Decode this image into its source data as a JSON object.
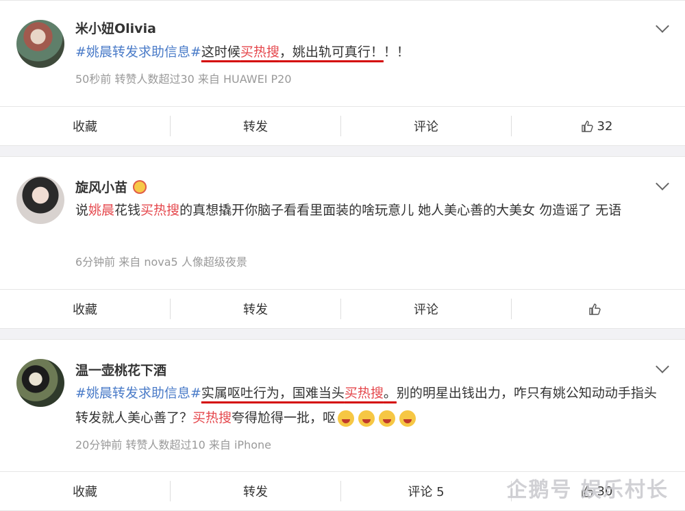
{
  "posts": [
    {
      "username": "米小妞Olivia",
      "text_segments": [
        "#姚晨转发求助信息#",
        "这时候",
        "买热搜",
        "，姚出轨可真行！",
        "！！"
      ],
      "meta": "50秒前  转赞人数超过30  来自 HUAWEI P20",
      "actions": {
        "fav": "收藏",
        "repost": "转发",
        "comment": "评论",
        "like_count": "32"
      }
    },
    {
      "username": "旋风小苗",
      "text_segments": [
        "说",
        "姚晨",
        "花钱",
        "买热搜",
        "的真想撬开你脑子看看里面装的啥玩意儿 她人美心善的大美女 勿造谣了 无语"
      ],
      "meta": "6分钟前  来自 nova5 人像超级夜景",
      "actions": {
        "fav": "收藏",
        "repost": "转发",
        "comment": "评论",
        "like_count": ""
      }
    },
    {
      "username": "温一壶桃花下酒",
      "text_segments": [
        "#姚晨转发求助信息#",
        "实属呕吐行为，国难当头",
        "买热搜",
        "。",
        "别的明星出钱出力，咋只有姚公知动动手指头转发就人美心善了？",
        "买热搜",
        "夸得尬得一批，呕"
      ],
      "meta": "20分钟前  转赞人数超过10  来自 iPhone",
      "actions": {
        "fav": "收藏",
        "repost": "转发",
        "comment": "评论 5",
        "like_count": "30"
      }
    }
  ],
  "watermark": "企鹅号 娱乐村长"
}
